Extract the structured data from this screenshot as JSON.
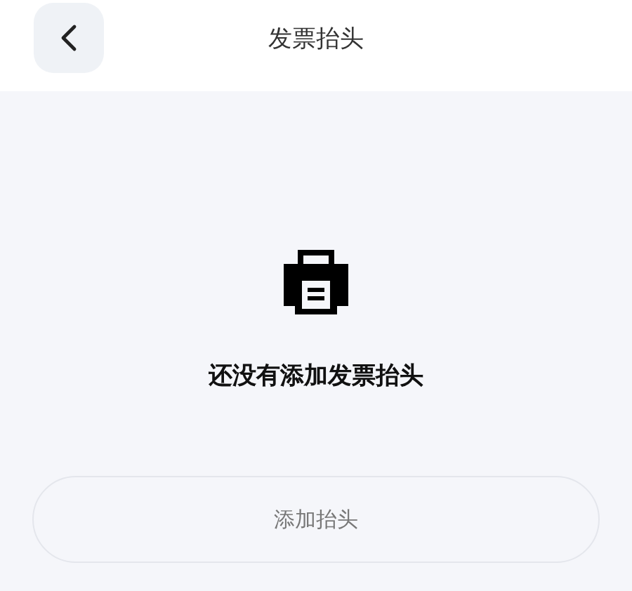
{
  "header": {
    "title": "发票抬头"
  },
  "empty_state": {
    "message": "还没有添加发票抬头"
  },
  "buttons": [
    {
      "label": "添加抬头",
      "kind": "outline"
    }
  ]
}
